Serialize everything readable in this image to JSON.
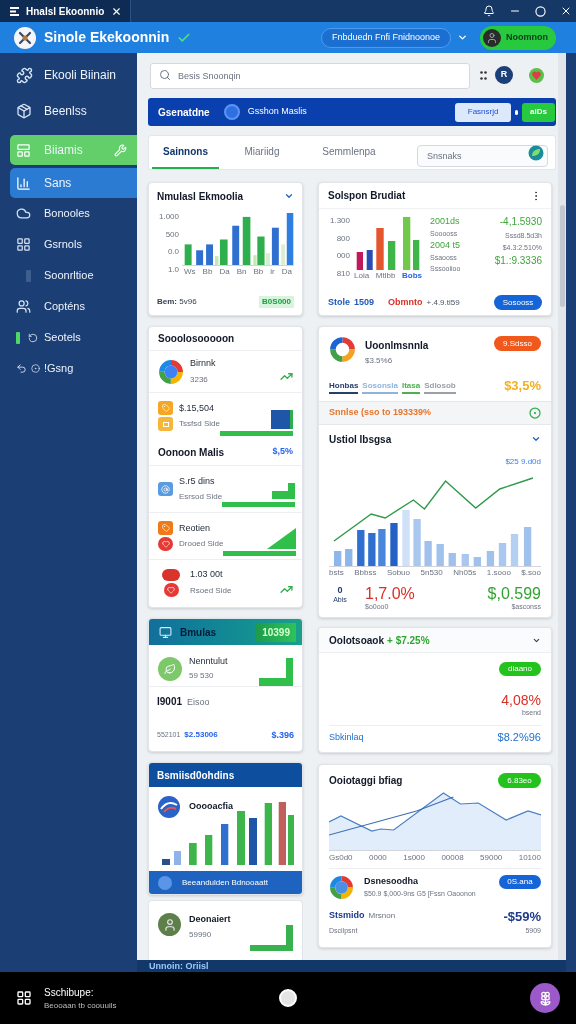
{
  "title_bar": {
    "title": "Hnalsl Ekoonnio"
  },
  "header": {
    "app_name": "Sinole Ekekoonnin",
    "workspace": "Fnbduedn Fnfi Fnidnoonoe",
    "user": "Noomnon"
  },
  "sidebar": {
    "items": [
      {
        "label": "Ekooli Biinain",
        "kind": "link",
        "selected": false
      },
      {
        "label": "Beenlss",
        "kind": "link",
        "selected": false
      },
      {
        "label": "Biiamis",
        "kind": "action",
        "selected": false
      },
      {
        "label": "Sans",
        "kind": "link",
        "selected": true
      },
      {
        "label": "Bonooles",
        "kind": "link",
        "selected": false
      },
      {
        "label": "Gsrnols",
        "kind": "link",
        "selected": false
      },
      {
        "label": "Soonrltioe",
        "kind": "link",
        "selected": false
      },
      {
        "label": "Copténs",
        "kind": "link",
        "selected": false
      },
      {
        "label": "Seotels",
        "kind": "link",
        "selected": false
      },
      {
        "label": "!Gsng",
        "kind": "link",
        "selected": false
      }
    ]
  },
  "toolbar": {
    "search_placeholder": "Besis Snoonqin",
    "avatar_initial": "R"
  },
  "banner": {
    "title": "Gsenatdne",
    "subtitle": "Gsshon Maslis",
    "buttons": [
      {
        "label": "Fasnsrjd",
        "kind": "secondary"
      },
      {
        "label": "aiDs",
        "kind": "primary"
      }
    ]
  },
  "tabs": [
    {
      "label": "Sainnons",
      "selected": true
    },
    {
      "label": "Miariidg",
      "selected": false
    },
    {
      "label": "Semmlenpa",
      "selected": false
    }
  ],
  "tab_search": {
    "placeholder": "Snsnaks"
  },
  "left_column": {
    "bar_chart_card": {
      "title": "Nmulasl Ekmoolia",
      "y_labels": [
        "1.000",
        "500",
        "0.0",
        "1.0"
      ],
      "x_labels": [
        "Ws",
        "Bb",
        "Da",
        "Bn",
        "Bb",
        "ir",
        "Da"
      ],
      "footer": "**Bem:** 5v96",
      "badge": "B0S000"
    },
    "activity_card": {
      "title": "Sooolosooooon",
      "entries": [
        {
          "kind": "trend",
          "title": "Birnnk",
          "subtitle": "3236"
        },
        {
          "kind": "bar",
          "title": "$.15,504",
          "subtitle": "Tssfsd Side"
        },
        {
          "kind": "heading",
          "title": "Oonoon Malis",
          "value": "$,5%"
        },
        {
          "kind": "step",
          "title": "S.r5 dins",
          "subtitle": "Esrsod Side"
        },
        {
          "kind": "ramp",
          "title": "Reotien",
          "subtitle": "Drooed Side"
        },
        {
          "kind": "trend",
          "title": "1.03 00t",
          "subtitle": "Rsoed Side"
        }
      ]
    },
    "highlight_card": {
      "title": "Bmulas",
      "badge": "10399",
      "item_title": "Nenntulut",
      "item_subtitle": "59 530",
      "code": "I9001",
      "code_label": "Eisoo",
      "footer_id": "552101",
      "footer_amount": "$2.53006",
      "footer_value": "$.396"
    },
    "growth_card": {
      "title": "Bsmiisd0ohdins",
      "label": "Ooooacfia",
      "footer": "Beeandulden Bdnooaatt"
    },
    "profile_card": {
      "title": "Deonaiert",
      "subtitle": "59990"
    }
  },
  "right_column": {
    "summary_card": {
      "title": "Solspon Brudiat",
      "y_labels": [
        "1.300",
        "800",
        "000",
        "810"
      ],
      "x_labels": [
        {
          "label": "Loia",
          "selected": false
        },
        {
          "label": "Mtlbb",
          "selected": false
        },
        {
          "label": "Bobs",
          "selected": true
        }
      ],
      "stats": [
        {
          "text": "2001ds",
          "kind": "value"
        },
        {
          "text": "Sooooss",
          "kind": "note"
        },
        {
          "text": "2004 t5",
          "kind": "value"
        },
        {
          "text": "Ssaooss",
          "kind": "note"
        },
        {
          "text": "Sssooiioo",
          "kind": "note"
        }
      ],
      "totals": [
        {
          "text": "-4,1.5930",
          "kind": "value"
        },
        {
          "text": "Sssd8.5d3h",
          "kind": "note"
        },
        {
          "text": "$4.3:2.510%",
          "kind": "note"
        },
        {
          "text": "$1.:9.3336",
          "kind": "value"
        }
      ],
      "footer_label": "Stole",
      "footer_value": "1509",
      "alert": "Obmnto",
      "change": "+.4.9.ti59",
      "button": "Sosooss"
    },
    "overview_card": {
      "title": "Uoonlmsnnla",
      "subtitle": "$3.5%6",
      "badge": "9.Sdsso",
      "legend": [
        {
          "label": "Honbas",
          "color": "#25406b"
        },
        {
          "label": "Sosonsla",
          "color": "#8fb3dc"
        },
        {
          "label": "Itasa",
          "color": "#4caf50"
        },
        {
          "label": "Sdlosob",
          "color": "#9aa0a6"
        }
      ],
      "total": "$3,5%",
      "alert": "Snnlse (sso to 193339%",
      "chart_title": "Ustiol Ibsgsa",
      "chart_value": "$25 9.d0d",
      "x_labels": [
        "bsts",
        "Bbbss",
        "Sobuo",
        "5n530",
        "Nh05s",
        "1.sooo",
        "$.soo"
      ],
      "axis_value": "0",
      "axis_label": "Abis",
      "change": "1,7.0%",
      "change_note": "$o0oo0",
      "amount": "$,0.599",
      "amount_note": "$asconss"
    },
    "change_card": {
      "title": "Oolotsoaok",
      "change": "+ $7.25%",
      "badge": "diaano",
      "value": "4,08%",
      "value_note": "bsend",
      "footer_label": "Sbkinlaq",
      "footer_value": "$8.2%96"
    },
    "trend_card": {
      "title": "Ooiotaggi bfiag",
      "badge": "6.83eo",
      "x_labels": [
        "Gs0d0",
        "0000",
        "1s000",
        "00008",
        "59000",
        "10100"
      ],
      "item_title": "Dsnesoodha",
      "item_subtitle": "$50.9 $,000-9ns G5 [Fssn Oaoonon",
      "button": "0S.ana",
      "footer_label": "Stsmido",
      "footer_sublabel": "Mrsnon",
      "footer_value": "-$59%",
      "footer_note": "Dscilpsnt",
      "footer_count": "5909"
    }
  },
  "status_strip": {
    "text": "Unnoin: Oriisl"
  },
  "nav_bar": {
    "title": "Sschibupe:",
    "subtitle": "Beooaan tb coouuils"
  }
}
